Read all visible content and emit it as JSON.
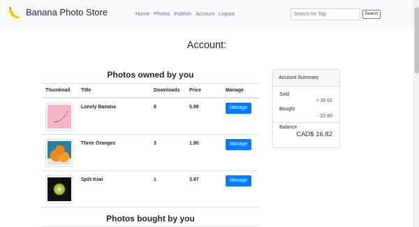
{
  "navbar": {
    "brand": "Banana Photo Store",
    "links": [
      "Home",
      "Photos",
      "Publish",
      "Account",
      "Logout"
    ],
    "search_placeholder": "Search for Tag",
    "search_button": "Search"
  },
  "page_title": "Account:",
  "owned": {
    "heading": "Photos owned by you",
    "columns": [
      "Thumbnail",
      "Title",
      "Downloads",
      "Price",
      "Manage"
    ],
    "rows": [
      {
        "title": "Lonely Banana",
        "downloads": "8",
        "price": "5.99",
        "action": "Manage",
        "thumb": "banana-photo"
      },
      {
        "title": "Three Oranges",
        "downloads": "3",
        "price": "1.90",
        "action": "Manage",
        "thumb": "oranges-photo"
      },
      {
        "title": "Split Kiwi",
        "downloads": "1",
        "price": "3.97",
        "action": "Manage",
        "thumb": "kiwi-photo"
      }
    ]
  },
  "bought": {
    "heading": "Photos bought by you"
  },
  "summary": {
    "title": "Account Summary",
    "sold_label": "Sold",
    "sold_value": "+ 39.62",
    "bought_label": "Bought",
    "bought_value": "- 22.80",
    "balance_label": "Balance",
    "balance_value": "CAD$ 16.82"
  },
  "colors": {
    "primary": "#007bff",
    "navbar_bg": "#f8f9fa",
    "banana_bg": "#f4b6c4",
    "oranges_bg": "#2f7fa3",
    "kiwi_bg": "#111111"
  }
}
